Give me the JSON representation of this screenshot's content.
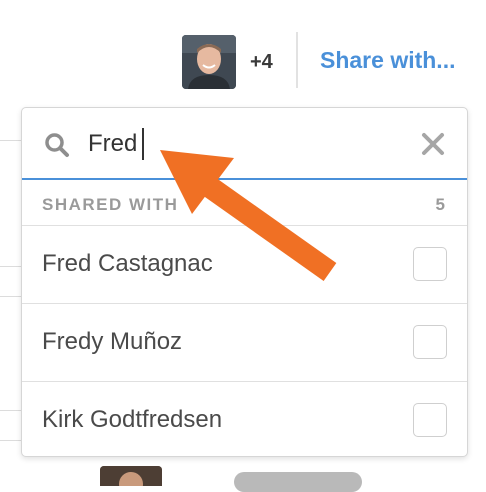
{
  "header": {
    "plus_count": "+4",
    "share_label": "Share with..."
  },
  "search": {
    "value": "Fred",
    "placeholder": ""
  },
  "section": {
    "label": "SHARED WITH",
    "count": "5"
  },
  "results": [
    {
      "name": "Fred Castagnac",
      "checked": false
    },
    {
      "name": "Fredy Muñoz",
      "checked": false
    },
    {
      "name": "Kirk Godtfredsen",
      "checked": false
    }
  ],
  "colors": {
    "accent": "#4a90d9",
    "annotation_arrow": "#f07024"
  },
  "icons": [
    "search-icon",
    "close-icon"
  ]
}
